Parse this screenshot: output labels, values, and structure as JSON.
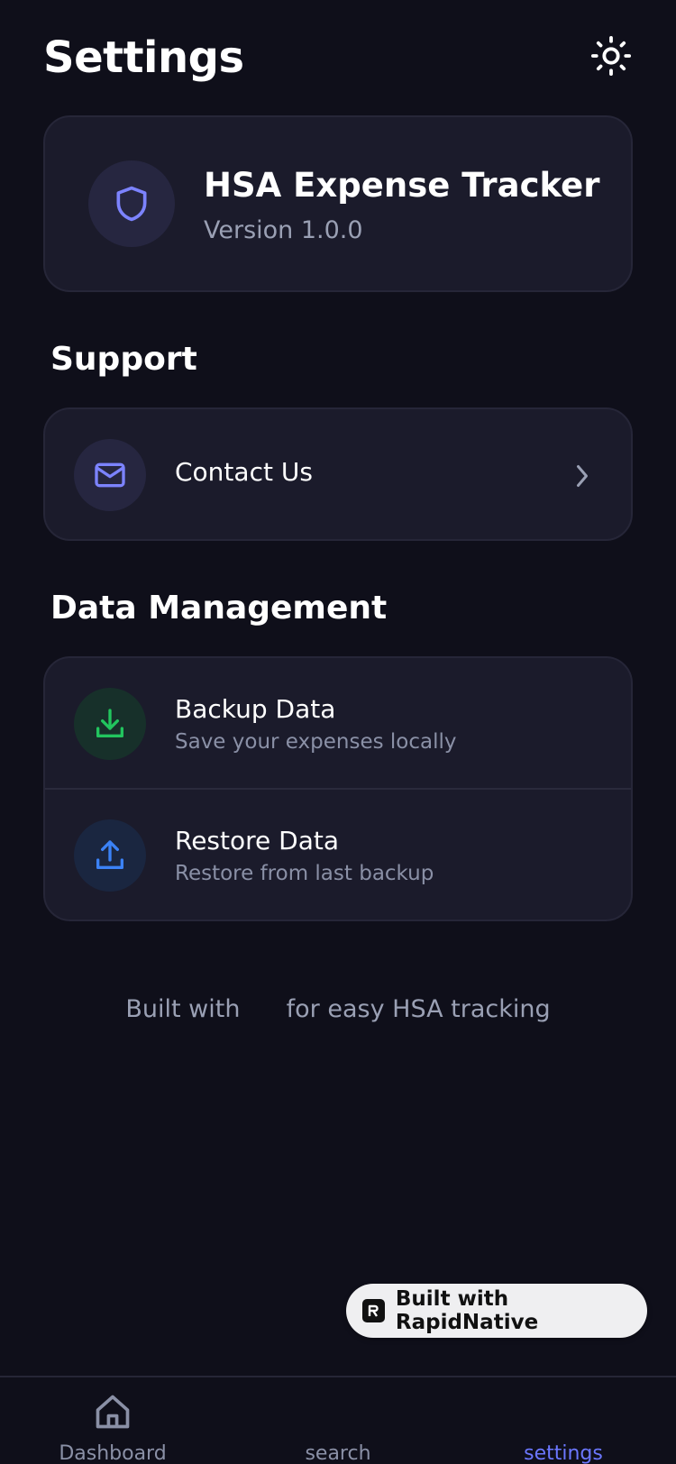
{
  "header": {
    "title": "Settings",
    "theme_icon": "sun-icon"
  },
  "app_card": {
    "name": "HSA Expense Tracker",
    "version": "Version 1.0.0",
    "icon": "shield-icon",
    "accent": "#7c83ff"
  },
  "support": {
    "title": "Support",
    "items": [
      {
        "label": "Contact Us",
        "icon": "mail-icon"
      }
    ]
  },
  "data_management": {
    "title": "Data Management",
    "items": [
      {
        "label": "Backup Data",
        "sublabel": "Save your expenses locally",
        "icon": "download-icon",
        "color": "#22c55e"
      },
      {
        "label": "Restore Data",
        "sublabel": "Restore from last backup",
        "icon": "upload-icon",
        "color": "#3b82f6"
      }
    ]
  },
  "footer": {
    "prefix": "Built with",
    "suffix": "for easy HSA tracking"
  },
  "badge": {
    "label": "Built with RapidNative"
  },
  "tabs": [
    {
      "label": "Dashboard",
      "icon": "home-icon",
      "active": false
    },
    {
      "label": "search",
      "icon": "search-icon",
      "active": false
    },
    {
      "label": "settings",
      "icon": "settings-icon",
      "active": true
    }
  ],
  "colors": {
    "background": "#0f0f1a",
    "card": "#1b1b2b",
    "active_tab": "#6b77ff"
  }
}
